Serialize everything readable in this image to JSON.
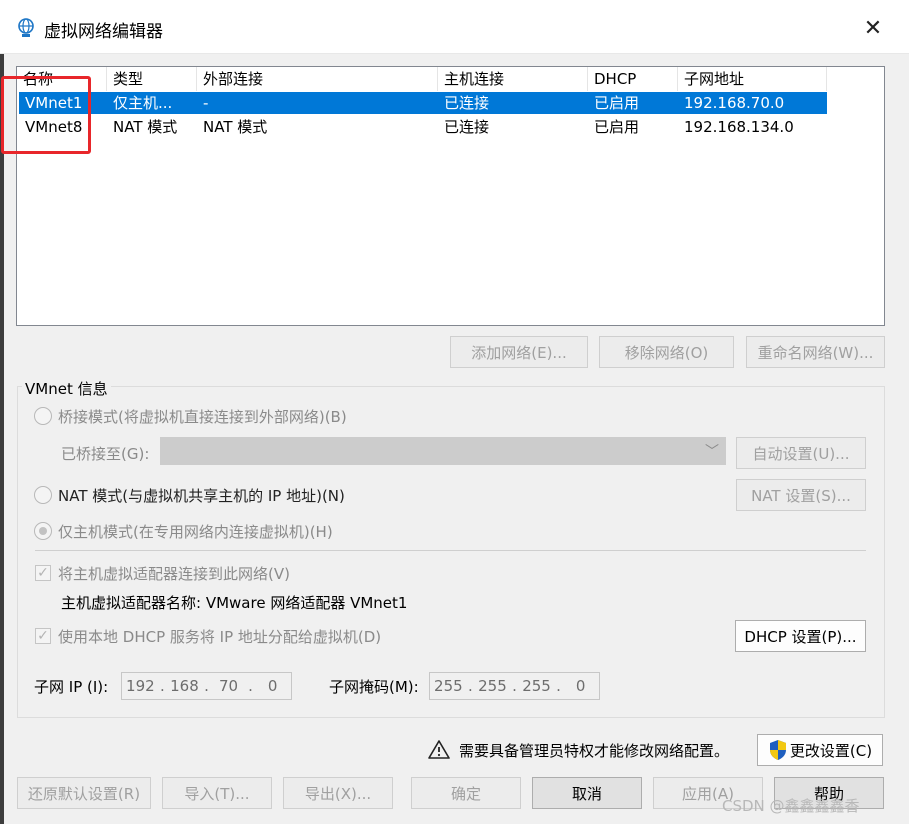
{
  "window": {
    "title": "虚拟网络编辑器",
    "close_glyph": "✕"
  },
  "network_list": {
    "columns": [
      "名称",
      "类型",
      "外部连接",
      "主机连接",
      "DHCP",
      "子网地址"
    ],
    "rows": [
      {
        "name": "VMnet1",
        "type": "仅主机...",
        "external": "-",
        "host": "已连接",
        "dhcp": "已启用",
        "subnet": "192.168.70.0",
        "selected": true
      },
      {
        "name": "VMnet8",
        "type": "NAT 模式",
        "external": "NAT 模式",
        "host": "已连接",
        "dhcp": "已启用",
        "subnet": "192.168.134.0",
        "selected": false
      }
    ]
  },
  "list_buttons": {
    "add": "添加网络(E)...",
    "remove": "移除网络(O)",
    "rename": "重命名网络(W)..."
  },
  "vmnet_info": {
    "legend": "VMnet 信息",
    "bridged_label": "桥接模式(将虚拟机直接连接到外部网络)(B)",
    "bridged_to_label": "已桥接至(G):",
    "bridged_to_value": "",
    "auto_settings": "自动设置(U)...",
    "nat_label": "NAT 模式(与虚拟机共享主机的 IP 地址)(N)",
    "nat_settings": "NAT 设置(S)...",
    "hostonly_label": "仅主机模式(在专用网络内连接虚拟机)(H)",
    "connect_adapter_label": "将主机虚拟适配器连接到此网络(V)",
    "adapter_name_label": "主机虚拟适配器名称: VMware 网络适配器 VMnet1",
    "dhcp_label": "使用本地 DHCP 服务将 IP 地址分配给虚拟机(D)",
    "dhcp_settings": "DHCP 设置(P)...",
    "subnet_ip_label": "子网 IP (I):",
    "subnet_ip": [
      "192",
      "168",
      "70",
      "0"
    ],
    "subnet_mask_label": "子网掩码(M):",
    "subnet_mask": [
      "255",
      "255",
      "255",
      "0"
    ]
  },
  "admin": {
    "notice": "需要具备管理员特权才能修改网络配置。",
    "change_settings": "更改设置(C)"
  },
  "footer_buttons": {
    "restore": "还原默认设置(R)",
    "import": "导入(T)...",
    "export": "导出(X)...",
    "ok": "确定",
    "cancel": "取消",
    "apply": "应用(A)",
    "help": "帮助"
  },
  "watermark": "CSDN @鑫鑫鑫鑫香",
  "colors": {
    "selection": "#0078d7",
    "highlight_box": "#e8262a"
  }
}
